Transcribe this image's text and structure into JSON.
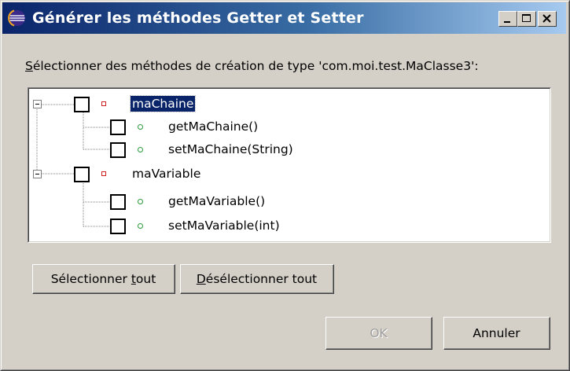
{
  "window": {
    "title": "Générer les méthodes Getter et Setter",
    "icon": "eclipse-icon",
    "controls": {
      "minimize": "minimize-icon",
      "maximize": "maximize-icon",
      "close": "close-icon"
    }
  },
  "instruction": {
    "mnemonic": "S",
    "rest": "électionner des méthodes de création de type 'com.moi.test.MaClasse3':"
  },
  "tree": {
    "nodes": [
      {
        "label": "maChaine",
        "kind": "field",
        "checked": false,
        "expanded": true,
        "selected": true,
        "children": [
          {
            "label": "getMaChaine()",
            "kind": "method",
            "checked": false
          },
          {
            "label": "setMaChaine(String)",
            "kind": "method",
            "checked": false
          }
        ]
      },
      {
        "label": "maVariable",
        "kind": "field",
        "checked": false,
        "expanded": true,
        "selected": false,
        "children": [
          {
            "label": "getMaVariable()",
            "kind": "method",
            "checked": false
          },
          {
            "label": "setMaVariable(int)",
            "kind": "method",
            "checked": false
          }
        ]
      }
    ]
  },
  "buttons": {
    "select_all": {
      "pre": "Sélectionner ",
      "mnemonic": "t",
      "post": "out"
    },
    "deselect_all": {
      "pre": "",
      "mnemonic": "D",
      "post": "ésélectionner tout"
    },
    "ok": {
      "label": "OK",
      "enabled": false
    },
    "cancel": {
      "label": "Annuler",
      "enabled": true
    }
  },
  "colors": {
    "title_gradient_start": "#0a246a",
    "title_gradient_end": "#a6caf0",
    "dialog_bg": "#d4d0c8",
    "selection_bg": "#0a246a",
    "field_icon": "#d02020",
    "method_icon": "#2a9a3a"
  }
}
